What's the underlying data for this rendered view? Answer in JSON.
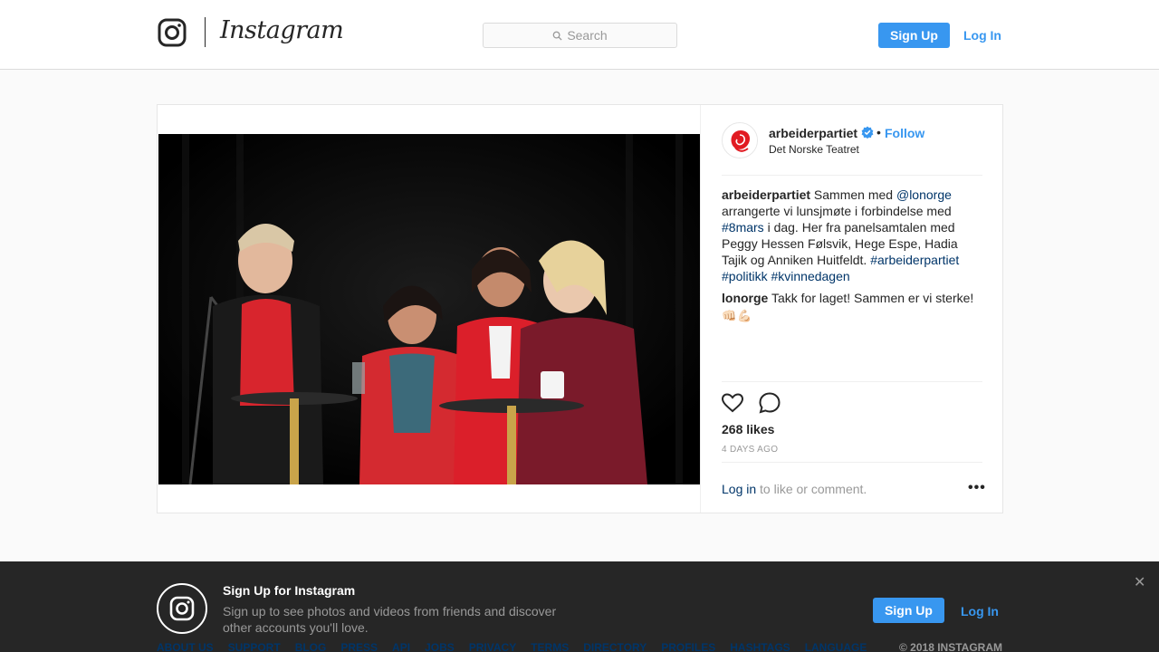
{
  "header": {
    "wordmark": "Instagram",
    "search_placeholder": "Search",
    "signup_label": "Sign Up",
    "login_label": "Log In"
  },
  "post": {
    "username": "arbeiderpartiet",
    "follow_label": "Follow",
    "dot": "•",
    "location": "Det Norske Teatret",
    "caption": {
      "author": "arbeiderpartiet",
      "t1": " Sammen med ",
      "mention": "@lonorge",
      "t2": " arrangerte vi lunsjmøte i forbindelse med ",
      "tag1": "#8mars",
      "t3": " i dag. Her fra panelsamtalen med Peggy Hessen Følsvik, Hege Espe, Hadia Tajik og Anniken Huitfeldt. ",
      "tag2": "#arbeiderpartiet",
      "tag3": "#politikk",
      "tag4": "#kvinnedagen"
    },
    "comment": {
      "author": "lonorge",
      "text": " Takk for laget! Sammen er vi sterke!",
      "emojis": "👊🏻💪🏻"
    },
    "likes": "268 likes",
    "time": "4 DAYS AGO",
    "login_prompt_link": "Log in",
    "login_prompt_text": " to like or comment.",
    "more": "•••"
  },
  "banner": {
    "title": "Sign Up for Instagram",
    "subtitle": "Sign up to see photos and videos from friends and discover other accounts you'll love.",
    "signup_label": "Sign Up",
    "login_label": "Log In",
    "close": "✕",
    "footer_links": [
      "ABOUT US",
      "SUPPORT",
      "BLOG",
      "PRESS",
      "API",
      "JOBS",
      "PRIVACY",
      "TERMS",
      "DIRECTORY",
      "PROFILES",
      "HASHTAGS",
      "LANGUAGE"
    ],
    "copyright": "© 2018 INSTAGRAM"
  },
  "colors": {
    "accent": "#3897f0",
    "link_dark": "#003569",
    "banner_bg": "#262626"
  }
}
